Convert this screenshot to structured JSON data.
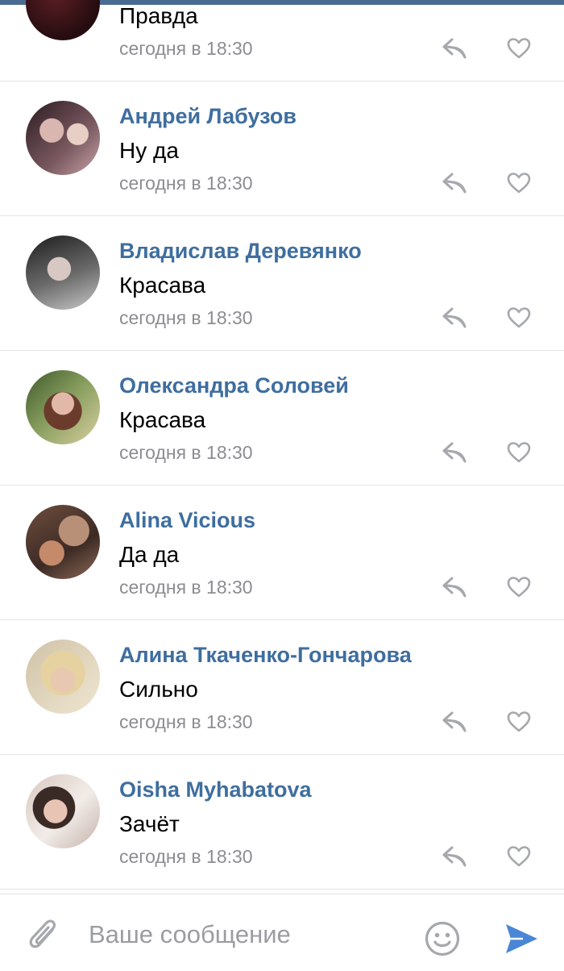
{
  "comments": [
    {
      "author": "",
      "text": "Правда",
      "time": "сегодня в 18:30"
    },
    {
      "author": "Андрей Лабузов",
      "text": "Ну да",
      "time": "сегодня в 18:30"
    },
    {
      "author": "Владислав Деревянко",
      "text": "Красава",
      "time": "сегодня в 18:30"
    },
    {
      "author": "Олександра Соловей",
      "text": "Красава",
      "time": "сегодня в 18:30"
    },
    {
      "author": "Alina Vicious",
      "text": "Да да",
      "time": "сегодня в 18:30"
    },
    {
      "author": "Алина Ткаченко-Гончарова",
      "text": "Сильно",
      "time": "сегодня в 18:30"
    },
    {
      "author": "Oisha Myhabatova",
      "text": "Зачёт",
      "time": "сегодня в 18:30"
    }
  ],
  "composer": {
    "placeholder": "Ваше сообщение"
  },
  "colors": {
    "accent": "#3f6e9f",
    "send": "#4a86d6",
    "muted": "#8b8d91",
    "icon": "#a5a8ad"
  },
  "icons": {
    "reply": "reply-icon",
    "like": "heart-icon",
    "attach": "paperclip-icon",
    "emoji": "smiley-icon",
    "send": "send-icon"
  }
}
